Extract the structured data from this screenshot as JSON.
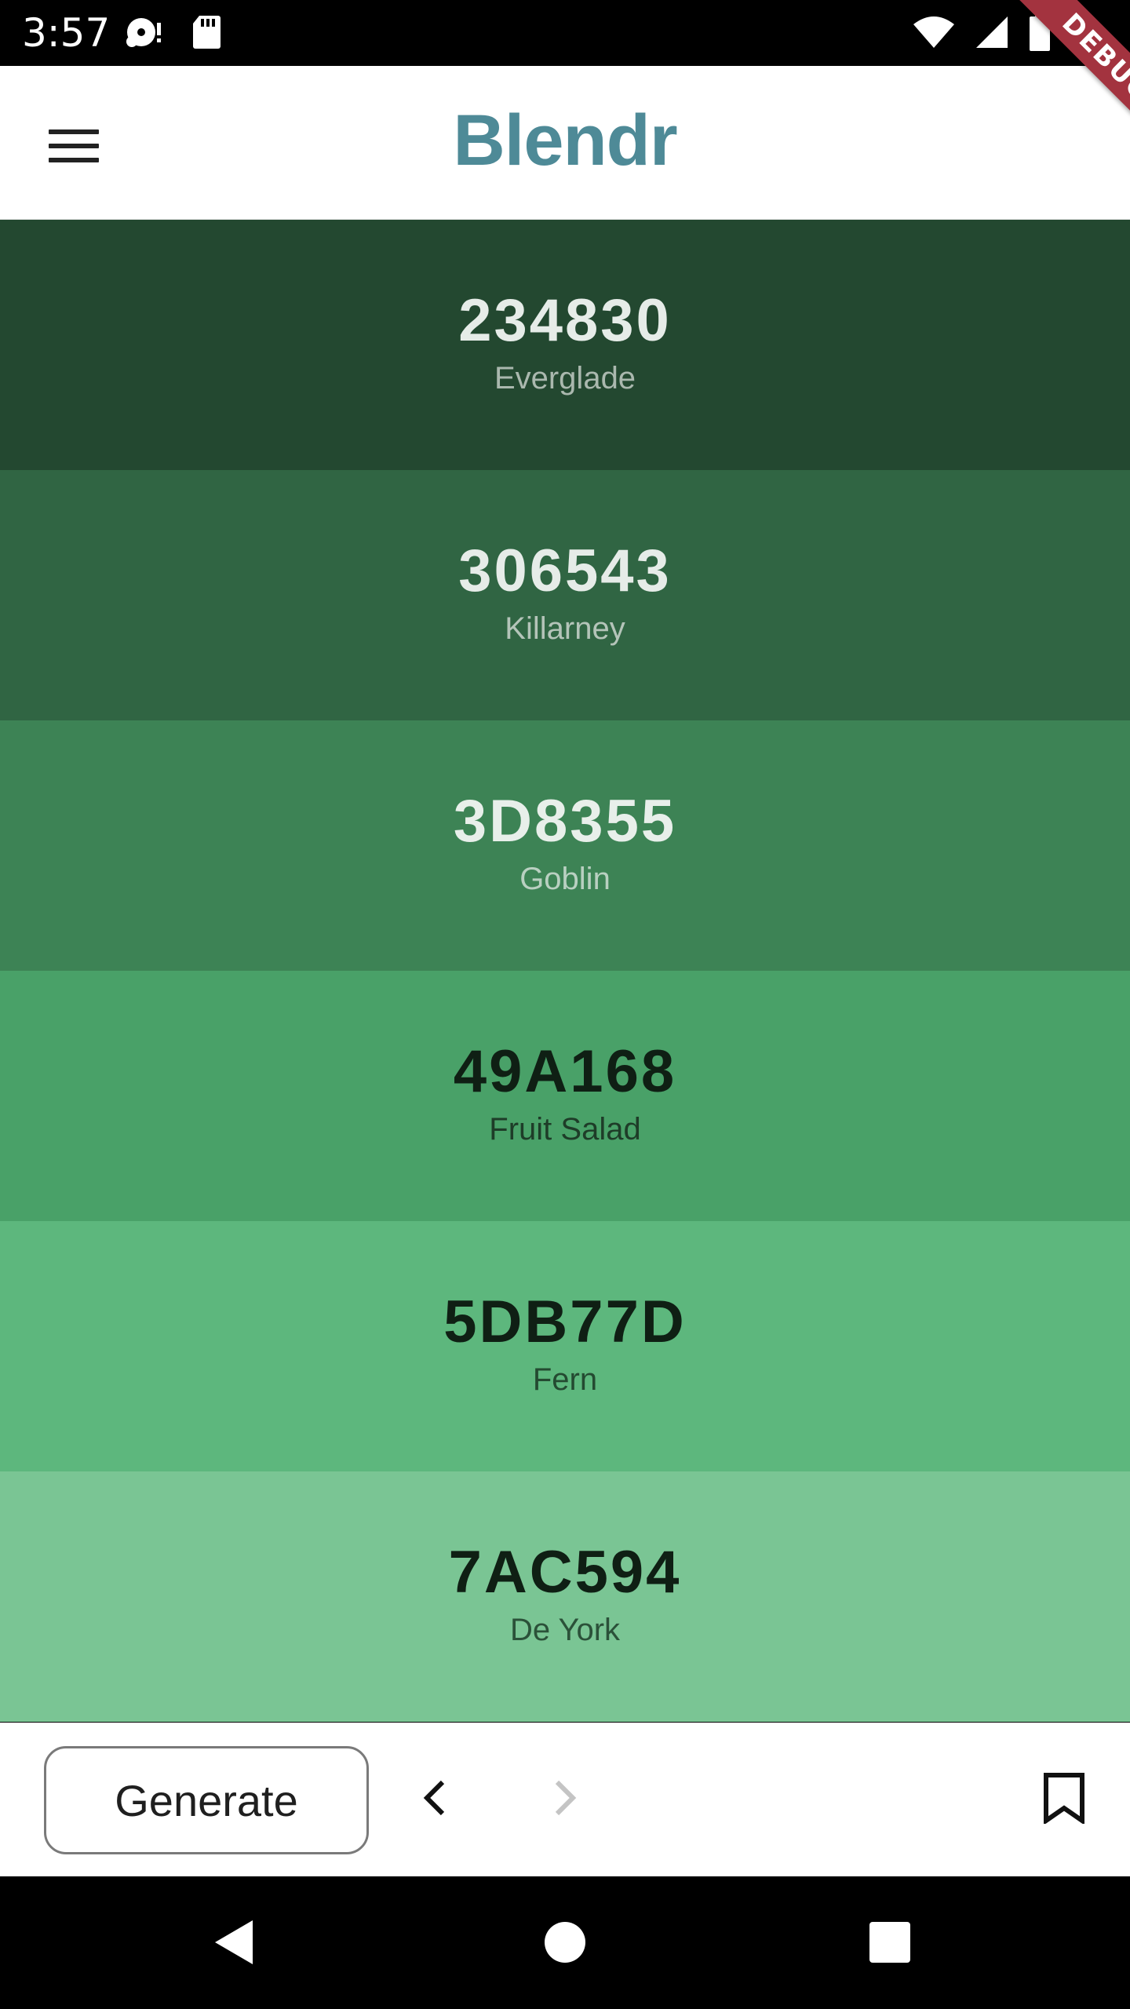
{
  "status_bar": {
    "time": "3:57",
    "left_icons": [
      "media-icon",
      "sd-card-icon"
    ],
    "right_icons": [
      "wifi-icon",
      "signal-icon",
      "battery-icon"
    ]
  },
  "debug_banner": {
    "label": "DEBUG",
    "color": "#a3333f"
  },
  "app_bar": {
    "title": "Blendr",
    "title_color": "#4e8a97",
    "menu_icon": "menu-icon"
  },
  "swatches": [
    {
      "hex": "234830",
      "name": "Everglade",
      "bg": "#234830",
      "text_color": "#e6ece8",
      "subtext_color": "#aab8ae"
    },
    {
      "hex": "306543",
      "name": "Killarney",
      "bg": "#306543",
      "text_color": "#e6ece8",
      "subtext_color": "#b4c4b9"
    },
    {
      "hex": "3D8355",
      "name": "Goblin",
      "bg": "#3d8355",
      "text_color": "#e8efea",
      "subtext_color": "#b9d0c1"
    },
    {
      "hex": "49A168",
      "name": "Fruit Salad",
      "bg": "#49a168",
      "text_color": "#0f1f14",
      "subtext_color": "#1e3c28"
    },
    {
      "hex": "5DB77D",
      "name": "Fern",
      "bg": "#5db77d",
      "text_color": "#0f1f14",
      "subtext_color": "#244a31"
    },
    {
      "hex": "7AC594",
      "name": "De York",
      "bg": "#7ac594",
      "text_color": "#0f1f14",
      "subtext_color": "#2b5139"
    }
  ],
  "toolbar": {
    "generate_label": "Generate",
    "prev_icon": "chevron-left-icon",
    "next_icon": "chevron-right-icon",
    "next_enabled": false,
    "bookmark_icon": "bookmark-icon"
  },
  "system_nav": {
    "buttons": [
      "back-icon",
      "home-icon",
      "recents-icon"
    ]
  }
}
